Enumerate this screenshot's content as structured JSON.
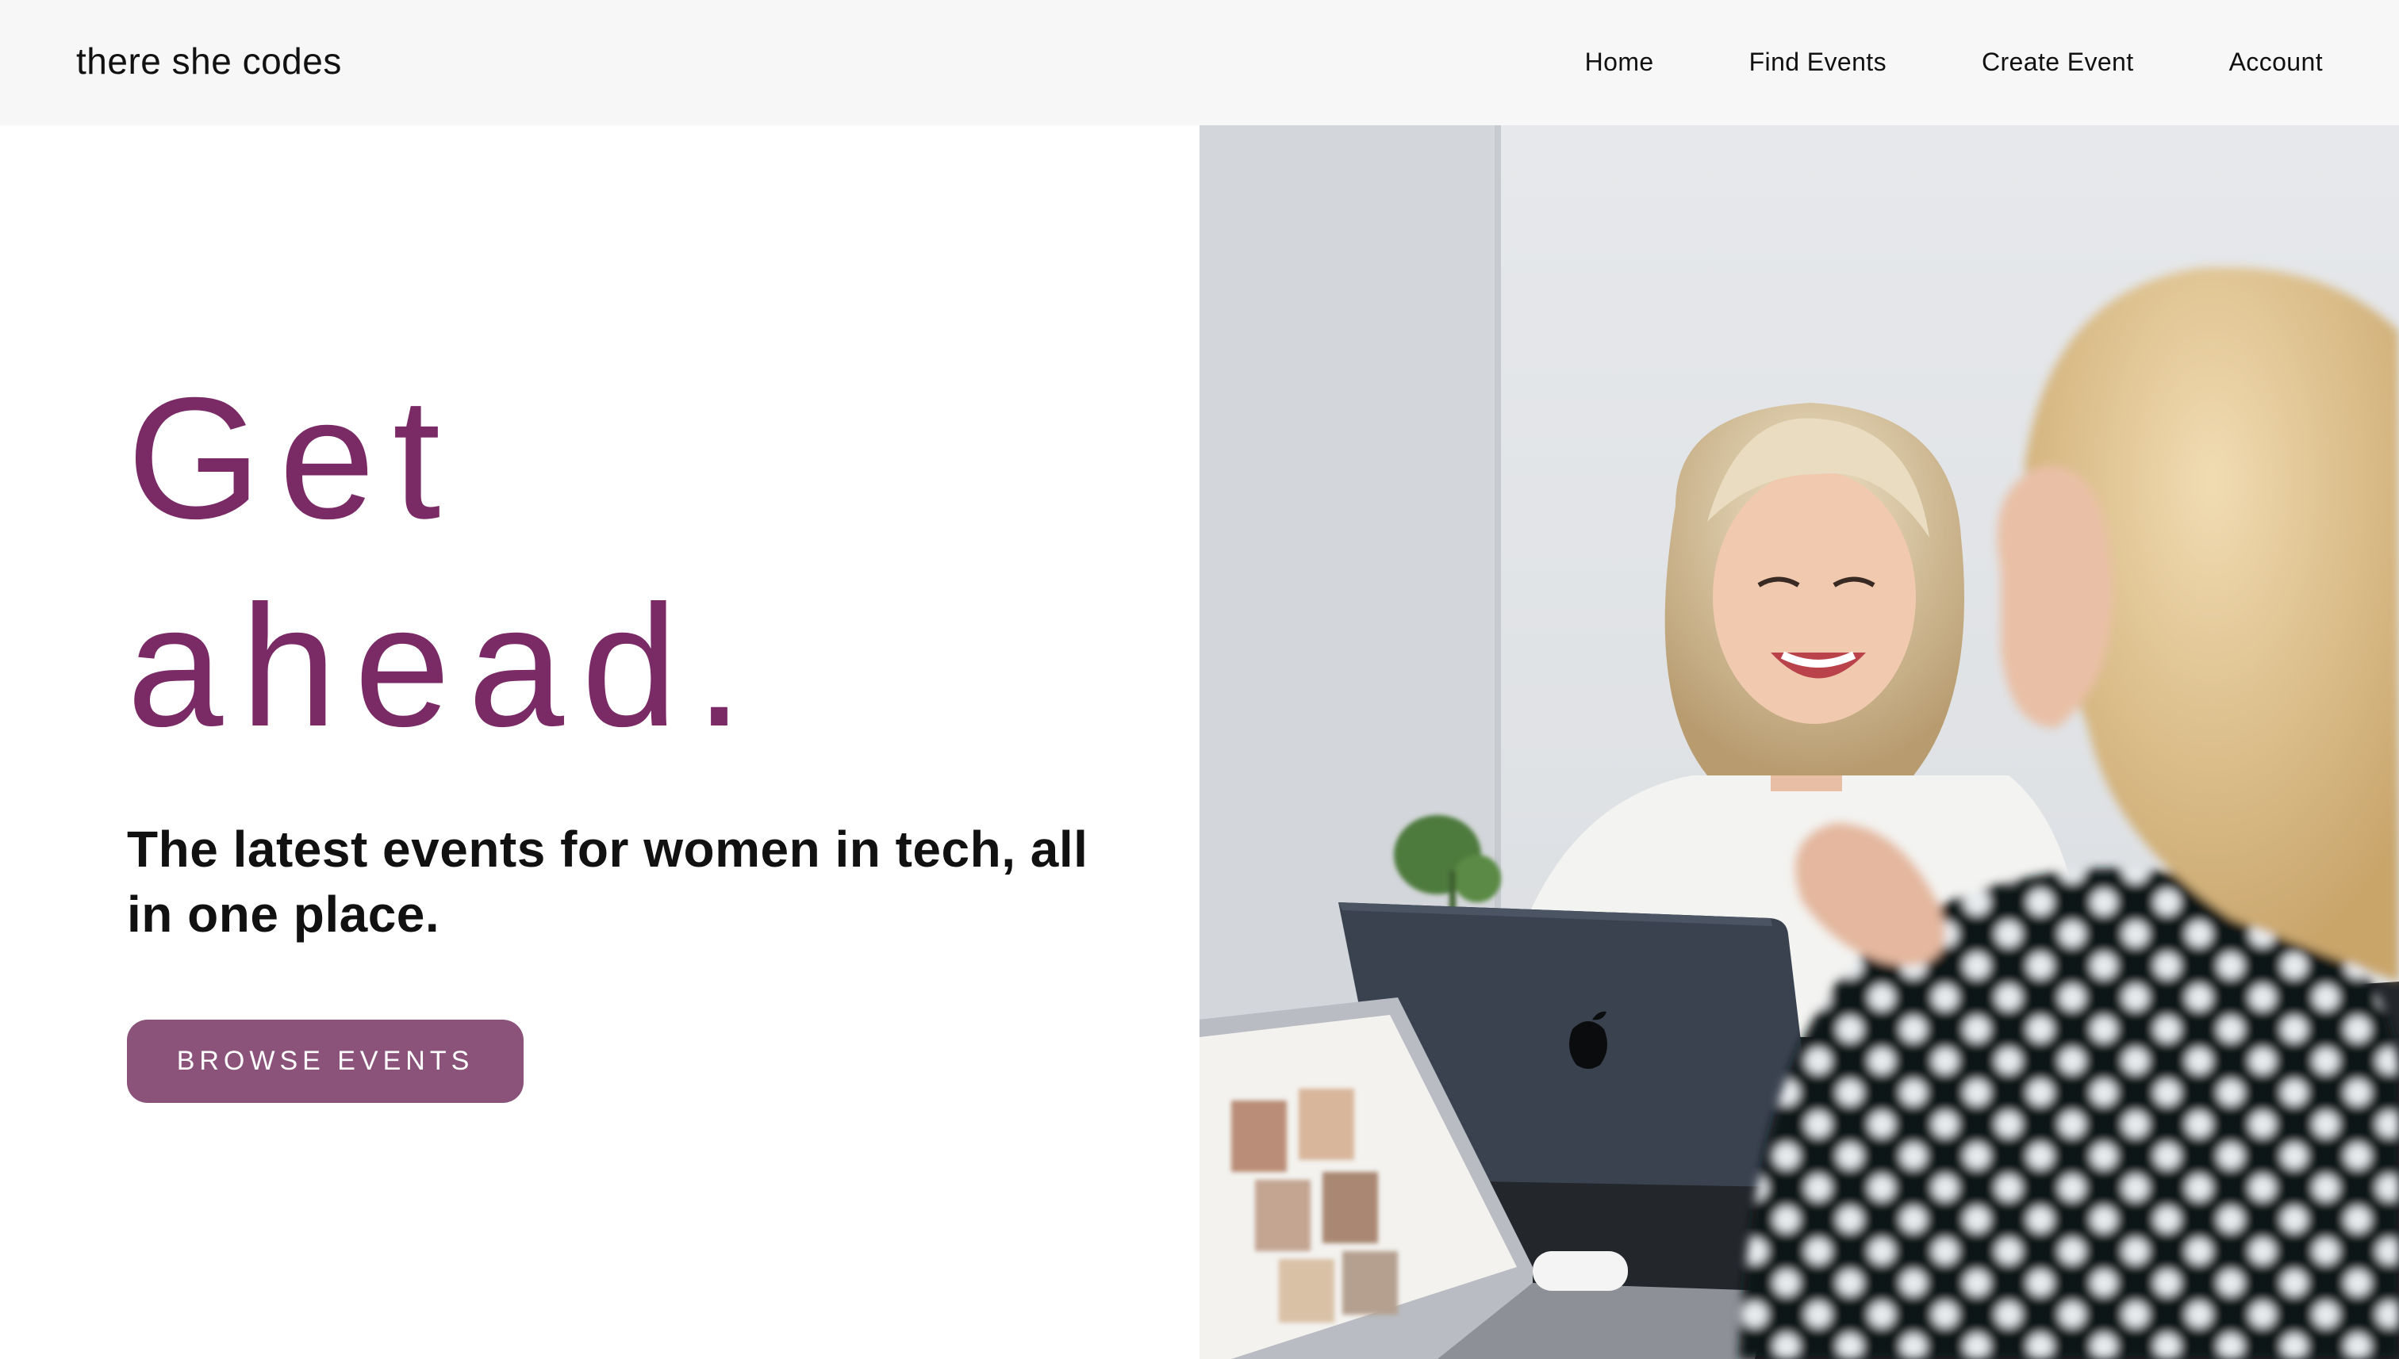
{
  "navbar": {
    "brand": "there she codes",
    "links": [
      {
        "label": "Home"
      },
      {
        "label": "Find Events"
      },
      {
        "label": "Create Event"
      },
      {
        "label": "Account"
      }
    ]
  },
  "hero": {
    "headline_line1": "Get",
    "headline_line2": "ahead.",
    "subheading": "The latest events for women in tech, all in one place.",
    "cta_label": "BROWSE EVENTS",
    "image_alt": "women-working-on-laptops-photo"
  },
  "colors": {
    "accent": "#7a2a64",
    "button": "#8b5379",
    "navbar_bg": "#f7f7f7",
    "text": "#111111"
  }
}
